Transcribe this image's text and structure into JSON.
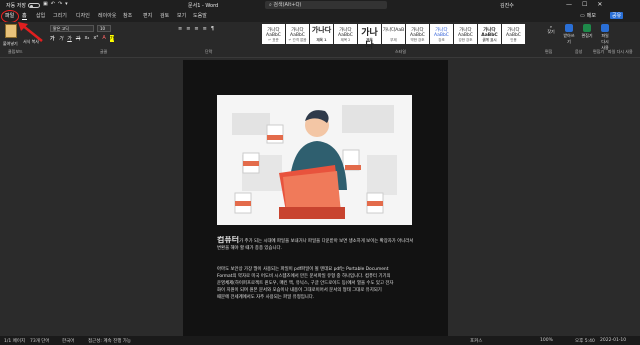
{
  "titlebar": {
    "autosave_label": "자동 저장",
    "toggle_state": "끔",
    "doc_title": "문서1 - Word",
    "search_placeholder": "검색(Alt+Q)",
    "user": "김진수",
    "min": "—",
    "max": "☐",
    "close": "✕"
  },
  "tabs": [
    {
      "label": "파일"
    },
    {
      "label": "홈"
    },
    {
      "label": "삽입"
    },
    {
      "label": "그리기"
    },
    {
      "label": "디자인"
    },
    {
      "label": "레이아웃"
    },
    {
      "label": "참조"
    },
    {
      "label": "편지"
    },
    {
      "label": "검토"
    },
    {
      "label": "보기"
    },
    {
      "label": "도움말"
    }
  ],
  "tab_right": {
    "comment": "메모",
    "share": "공유"
  },
  "ribbon": {
    "paste_label": "붙여넣기",
    "format_painter": "서식 복사",
    "font_name": "맑은 고딕",
    "font_size": "10",
    "font_buttons": [
      "가",
      "가",
      "가",
      "가",
      "x₂",
      "x²",
      "A",
      "가"
    ],
    "para_buttons": [
      "≡",
      "≡",
      "≡",
      "≡",
      "¶"
    ],
    "styles": [
      {
        "preview": "가나다AaBbC",
        "name": "↵ 표준"
      },
      {
        "preview": "가나다AaBbC",
        "name": "↵ 간격 없음"
      },
      {
        "preview": "가나다",
        "name": "제목 1"
      },
      {
        "preview": "가나다AaBbC",
        "name": "제목 2"
      },
      {
        "preview": "가나다",
        "name": "제목"
      },
      {
        "preview": "가나다AaB",
        "name": "부제"
      },
      {
        "preview": "가나다AaBbC",
        "name": "약한 강조"
      },
      {
        "preview": "가나다AaBbC",
        "name": "강조"
      },
      {
        "preview": "가나다AaBbC",
        "name": "강한 강조"
      },
      {
        "preview": "가나다AaBbC",
        "name": "굵게 표시"
      },
      {
        "preview": "가나다AaBbC",
        "name": "인용"
      }
    ],
    "find": "찾기",
    "replace": "바꾸기",
    "select": "선택",
    "dictate": "받아쓰기",
    "editor": "편집기",
    "reuse": "파일 다시 사용",
    "groups": {
      "clipboard": "클립보드",
      "font": "글꼴",
      "paragraph": "단락",
      "styles": "스타일",
      "editing": "편집",
      "voice": "음성",
      "editor_g": "편집기",
      "reuse_g": "파일 다시 사용"
    }
  },
  "document": {
    "heading": "컴퓨터",
    "p1": "가 주가 되는 시대에 파일을 보내거나 파일을 다운받아 보면 생소하게 보이는 확장자가 아니라서 변환을 해야 할 때가 종종 있습니다.",
    "p2_line1": "아마도 보안상 가장 많이 사용되는 파일이 pdf파일이 될 텐데요 pdf는 Portable Document",
    "p2_line2": "Format의 약자로 미국 어도비 시스템즈에서 만든 문서파일 유형 중 하나입니다. 컴퓨터 기기의",
    "p2_line3": "운영체제(하이퍼프로젝트 윈도우, 매킨 맥, 유닉스, 구글 안드로이드 등)에서 열을 수도 있고 전자",
    "p2_line4": "화이 지원이 되며 원본 문서와 모습이나 내용이 그대로이어서 문서의 형태 그대로 유지되기",
    "p2_line5": "때문에 전세계에서도 자주 사용되는 파일 유형입니다."
  },
  "statusbar": {
    "page": "1/1 페이지",
    "words": "73개 단어",
    "lang": "한국어",
    "accessibility": "접근성: 계속 진행 가능",
    "focus": "포커스",
    "zoom": "100%",
    "time": "오후 5:40",
    "date": "2022-01-10"
  }
}
